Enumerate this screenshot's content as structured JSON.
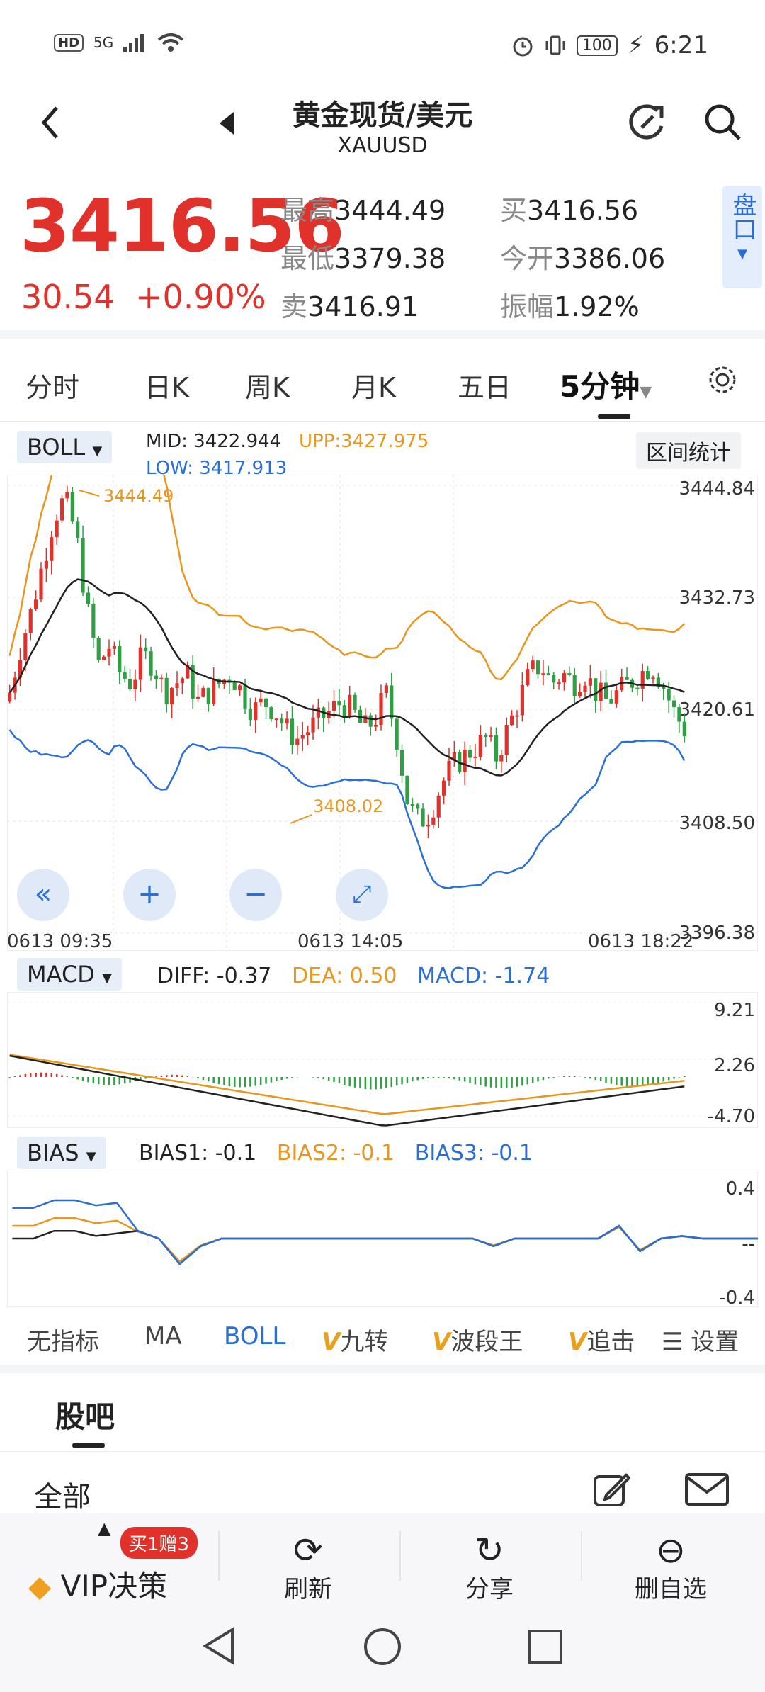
{
  "status_bar": {
    "time": "6:21",
    "battery": "100",
    "network": "HD",
    "signal": "5G"
  },
  "header": {
    "title": "黄金现货/美元",
    "symbol": "XAUUSD"
  },
  "quote": {
    "price": "3416.56",
    "change": "30.54",
    "change_pct": "+0.90%",
    "high_label": "最高",
    "high": "3444.49",
    "low_label": "最低",
    "low": "3379.38",
    "sell_label": "卖",
    "sell": "3416.91",
    "buy_label": "买",
    "buy": "3416.56",
    "open_label": "今开",
    "open": "3386.06",
    "amp_label": "振幅",
    "amp": "1.92%",
    "pankou": "盘口"
  },
  "tabs": [
    "分时",
    "日K",
    "周K",
    "月K",
    "五日",
    "5分钟"
  ],
  "main_chart": {
    "indicator": "BOLL",
    "mid_label": "MID:",
    "mid": "3422.944",
    "upp_label": "UPP:",
    "upp": "3427.975",
    "low_label": "LOW:",
    "low": "3417.913",
    "range_stats": "区间统计",
    "y_ticks": [
      "3444.84",
      "3432.73",
      "3420.61",
      "3408.50",
      "3396.38"
    ],
    "x_ticks": [
      "0613  09:35",
      "0613  14:05",
      "0613  18:22"
    ],
    "max_note": "3444.49",
    "min_note": "3408.02"
  },
  "macd": {
    "name": "MACD",
    "diff": "DIFF: -0.37",
    "dea": "DEA: 0.50",
    "macd": "MACD: -1.74",
    "y_ticks": [
      "9.21",
      "2.26",
      "-4.70"
    ]
  },
  "bias": {
    "name": "BIAS",
    "b1": "BIAS1: -0.1",
    "b2": "BIAS2: -0.1",
    "b3": "BIAS3: -0.1",
    "y_ticks": [
      "0.4",
      "--",
      "-0.4"
    ]
  },
  "indicator_bar": {
    "items": [
      "无指标",
      "MA",
      "BOLL",
      "九转",
      "波段王",
      "追击",
      "设置"
    ]
  },
  "community": {
    "title": "股吧",
    "filter": "全部"
  },
  "bottom_nav": {
    "vip": "VIP决策",
    "promo": "买1赠3",
    "refresh": "刷新",
    "share": "分享",
    "remove": "删自选"
  },
  "colors": {
    "up": "#e0312b",
    "down": "#2ea043",
    "boll_upp": "#e8961e",
    "boll_low": "#2a6fd6",
    "boll_mid": "#222222",
    "accent": "#2a6fd6"
  }
}
